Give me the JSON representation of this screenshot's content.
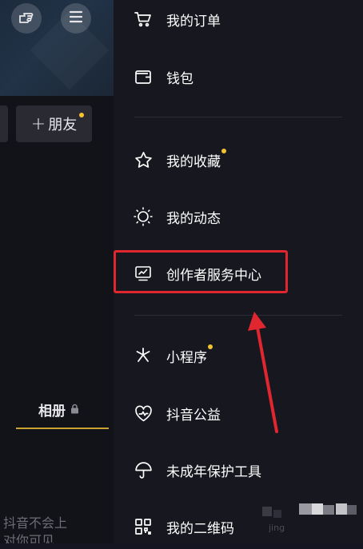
{
  "left": {
    "friend_button": "+ 朋友",
    "friend_plus": "+",
    "friend_label": "朋友",
    "album_tab": "相册",
    "bottom_note_line1": "抖音不会上",
    "bottom_note_line2": "对你可见"
  },
  "drawer": {
    "items": [
      {
        "label": "我的订单",
        "icon": "cart-icon"
      },
      {
        "label": "钱包",
        "icon": "wallet-icon"
      },
      {
        "label": "我的收藏",
        "icon": "star-icon",
        "dot": true
      },
      {
        "label": "我的动态",
        "icon": "sun-icon"
      },
      {
        "label": "创作者服务中心",
        "icon": "creator-chart-icon",
        "highlighted": true
      },
      {
        "label": "小程序",
        "icon": "mini-program-icon",
        "dot": true
      },
      {
        "label": "抖音公益",
        "icon": "heart-charity-icon"
      },
      {
        "label": "未成年保护工具",
        "icon": "umbrella-icon"
      },
      {
        "label": "我的二维码",
        "icon": "qrcode-icon"
      }
    ]
  },
  "watermark_text": "jing",
  "colors": {
    "highlight": "#e0262f",
    "badge_dot": "#f5c230",
    "drawer_bg": "#17181f",
    "album_underline": "#c8a533"
  }
}
